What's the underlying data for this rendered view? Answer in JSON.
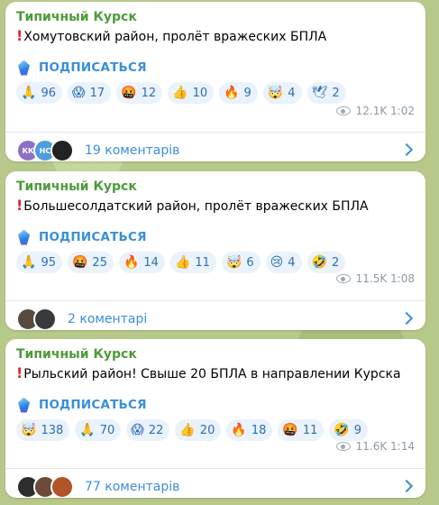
{
  "posts": [
    {
      "channel": "Типичный Курск",
      "icon": "red-exclamation-icon",
      "text": "Хомутовский район, пролёт вражеских БПЛА",
      "subscribe": "ПОДПИСАТЬСЯ",
      "reactions": [
        {
          "emoji": "🙏",
          "count": "96"
        },
        {
          "emoji": "😱",
          "count": "17"
        },
        {
          "emoji": "🤬",
          "count": "12"
        },
        {
          "emoji": "👍",
          "count": "10"
        },
        {
          "emoji": "🔥",
          "count": "9"
        },
        {
          "emoji": "🤯",
          "count": "4"
        },
        {
          "emoji": "🕊",
          "count": "2"
        }
      ],
      "views": "12.1K",
      "time": "1:02",
      "avatars": [
        "КК",
        "НС",
        ""
      ],
      "comments": "19 коментарів"
    },
    {
      "channel": "Типичный Курск",
      "icon": "red-exclamation-icon",
      "text": "Большесолдатский район, пролёт вражеских БПЛА",
      "subscribe": "ПОДПИСАТЬСЯ",
      "reactions": [
        {
          "emoji": "🙏",
          "count": "95"
        },
        {
          "emoji": "🤬",
          "count": "25"
        },
        {
          "emoji": "🔥",
          "count": "14"
        },
        {
          "emoji": "👍",
          "count": "11"
        },
        {
          "emoji": "🤯",
          "count": "6"
        },
        {
          "emoji": "😢",
          "count": "4"
        },
        {
          "emoji": "🤣",
          "count": "2"
        }
      ],
      "views": "11.5K",
      "time": "1:08",
      "avatars": [
        "",
        ""
      ],
      "comments": "2 коментарі"
    },
    {
      "channel": "Типичный Курск",
      "icon": "red-exclamation-icon",
      "text": "Рыльский район! Свыше 20 БПЛА в направлении Курска",
      "subscribe": "ПОДПИСАТЬСЯ",
      "reactions": [
        {
          "emoji": "🤯",
          "count": "138"
        },
        {
          "emoji": "🙏",
          "count": "70"
        },
        {
          "emoji": "😱",
          "count": "22"
        },
        {
          "emoji": "👍",
          "count": "20"
        },
        {
          "emoji": "🔥",
          "count": "18"
        },
        {
          "emoji": "🤬",
          "count": "11"
        },
        {
          "emoji": "🤣",
          "count": "9"
        }
      ],
      "views": "11.6K",
      "time": "1:14",
      "avatars": [
        "",
        "",
        ""
      ],
      "comments": "77 коментарів"
    }
  ],
  "colors": {
    "channel": "#4c9b3a",
    "link": "#3a8fd8",
    "reaction_bg": "#eaf2fb",
    "exclamation": "#e0262b"
  }
}
